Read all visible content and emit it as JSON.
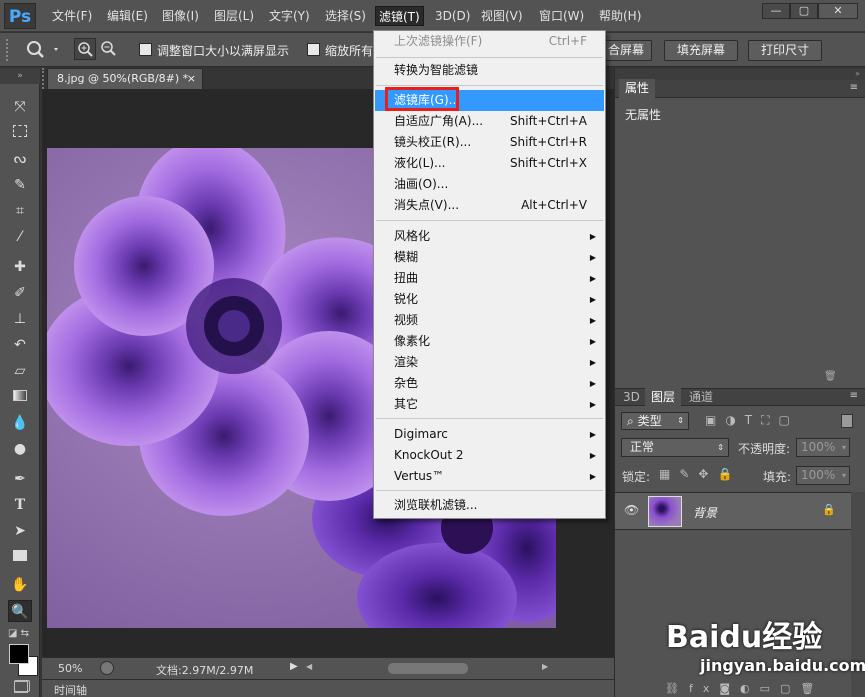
{
  "app": {
    "logo": "Ps"
  },
  "menubar": {
    "items": [
      "文件(F)",
      "编辑(E)",
      "图像(I)",
      "图层(L)",
      "文字(Y)",
      "选择(S)",
      "滤镜(T)",
      "3D(D)",
      "视图(V)",
      "窗口(W)",
      "帮助(H)"
    ],
    "active": "滤镜(T)"
  },
  "window_controls": {
    "minimize": "—",
    "restore": "▢",
    "close": "✕"
  },
  "options_bar": {
    "checkbox1_label": "调整窗口大小以满屏显示",
    "checkbox2_label": "缩放所有",
    "fit_screen": "合屏幕",
    "fill_screen": "填充屏幕",
    "print_size": "打印尺寸"
  },
  "document": {
    "tab_title": "8.jpg @ 50%(RGB/8#) *",
    "tab_close": "×",
    "zoom": "50%",
    "doc_info": "文档:2.97M/2.97M"
  },
  "timeline": {
    "label": "时间轴"
  },
  "properties_panel": {
    "tab": "属性",
    "content": "无属性"
  },
  "layers_panel": {
    "tabs": [
      "3D",
      "图层",
      "通道"
    ],
    "active_tab": "图层",
    "filter_kind": "类型",
    "blend_mode": "正常",
    "opacity_label": "不透明度:",
    "opacity_value": "100%",
    "lock_label": "锁定:",
    "fill_label": "填充:",
    "fill_value": "100%",
    "layers": [
      {
        "name": "背景",
        "locked": true,
        "visible": true
      }
    ]
  },
  "filter_menu": {
    "items": [
      {
        "label": "上次滤镜操作(F)",
        "shortcut": "Ctrl+F",
        "disabled": true
      },
      {
        "label": "转换为智能滤镜"
      },
      {
        "label": "滤镜库(G)...",
        "highlighted": true
      },
      {
        "label": "自适应广角(A)...",
        "shortcut": "Shift+Ctrl+A"
      },
      {
        "label": "镜头校正(R)...",
        "shortcut": "Shift+Ctrl+R"
      },
      {
        "label": "液化(L)...",
        "shortcut": "Shift+Ctrl+X"
      },
      {
        "label": "油画(O)..."
      },
      {
        "label": "消失点(V)...",
        "shortcut": "Alt+Ctrl+V"
      },
      {
        "label": "风格化",
        "submenu": true
      },
      {
        "label": "模糊",
        "submenu": true
      },
      {
        "label": "扭曲",
        "submenu": true
      },
      {
        "label": "锐化",
        "submenu": true
      },
      {
        "label": "视频",
        "submenu": true
      },
      {
        "label": "像素化",
        "submenu": true
      },
      {
        "label": "渲染",
        "submenu": true
      },
      {
        "label": "杂色",
        "submenu": true
      },
      {
        "label": "其它",
        "submenu": true
      },
      {
        "label": "Digimarc",
        "submenu": true
      },
      {
        "label": "KnockOut 2",
        "submenu": true
      },
      {
        "label": "Vertus™",
        "submenu": true
      },
      {
        "label": "浏览联机滤镜..."
      }
    ]
  },
  "watermark": {
    "brand": "Baidu经验",
    "url": "jingyan.baidu.com"
  },
  "colors": {
    "highlight": "#3399ff",
    "callout": "#e8201c",
    "ps_blue": "#49a9ff"
  }
}
